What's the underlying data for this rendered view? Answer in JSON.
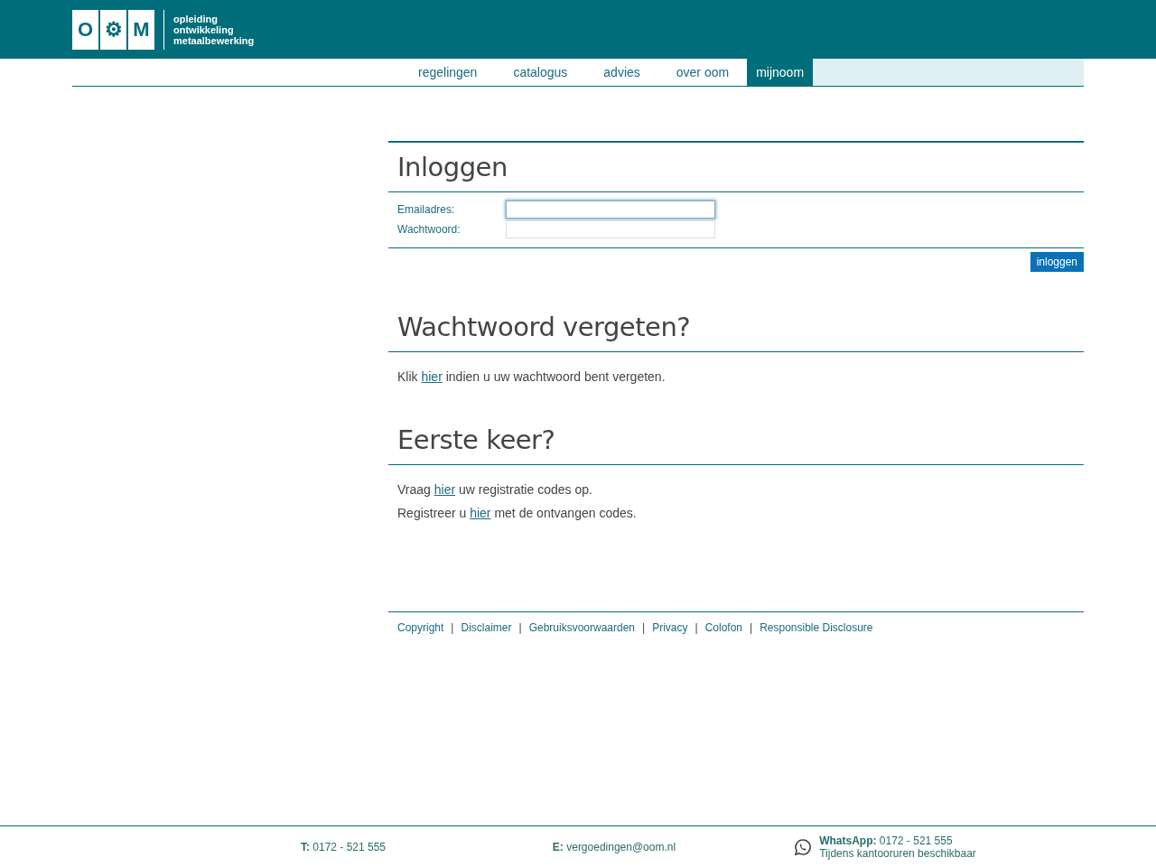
{
  "header": {
    "logo_letters": [
      "O",
      "⚙",
      "M"
    ],
    "logo_lines": [
      "opleiding",
      "ontwikkeling",
      "metaalbewerking"
    ]
  },
  "nav": [
    {
      "label": "regelingen",
      "selected": false
    },
    {
      "label": "catalogus",
      "selected": false
    },
    {
      "label": "advies",
      "selected": false
    },
    {
      "label": "over oom",
      "selected": false
    },
    {
      "label": "mijnoom",
      "selected": true
    }
  ],
  "login": {
    "title": "Inloggen",
    "fields": [
      {
        "label": "Emailadres:",
        "focused": true
      },
      {
        "label": "Wachtwoord:",
        "focused": false
      }
    ],
    "button": "inloggen"
  },
  "sections": [
    {
      "title": "Wachtwoord vergeten?",
      "paragraphs": [
        {
          "before": "Klik",
          "link": "hier",
          "after": "indien u uw wachtwoord bent vergeten."
        }
      ]
    },
    {
      "title": "Eerste keer?",
      "paragraphs": [
        {
          "before": "Vraag",
          "link": "hier",
          "after": "uw registratie codes op."
        },
        {
          "before": "Registreer u",
          "link": "hier",
          "after": "met de ontvangen codes."
        }
      ]
    }
  ],
  "footer_links": {
    "separator": "|",
    "links": [
      "Copyright",
      "Disclaimer",
      "Gebruiksvoorwaarden",
      "Privacy",
      "Colofon",
      "Responsible Disclosure"
    ]
  },
  "contact": {
    "phone": {
      "label": "T:",
      "value": "0172 - 521 555"
    },
    "email": {
      "label": "E:",
      "value": "vergoedingen@oom.nl"
    },
    "whatsapp": {
      "label": "WhatsApp:",
      "value": "0172 - 521 555",
      "note": "Tijdens kantooruren beschikbaar"
    }
  }
}
